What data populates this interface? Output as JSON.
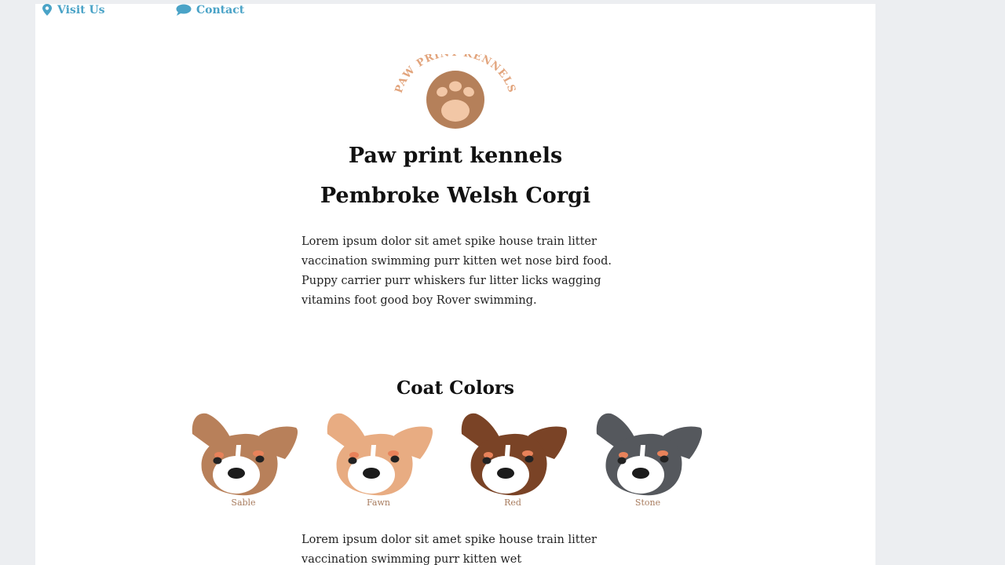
{
  "nav": {
    "visit_label": "Visit Us",
    "contact_label": "Contact"
  },
  "logo": {
    "arc_text": "PAW PRINT KENNELS"
  },
  "header": {
    "site_title": "Paw print kennels",
    "breed_title": "Pembroke Welsh Corgi"
  },
  "intro": {
    "paragraph": "Lorem ipsum dolor sit amet spike house train litter vaccination swimming purr kitten wet nose bird food. Puppy carrier purr whiskers fur litter licks wagging vitamins foot good boy Rover swimming."
  },
  "coat_colors": {
    "title": "Coat Colors",
    "items": [
      {
        "label": "Sable",
        "color": "#b8805a"
      },
      {
        "label": "Fawn",
        "color": "#e8ac82"
      },
      {
        "label": "Red",
        "color": "#7a4326"
      },
      {
        "label": "Stone",
        "color": "#55585d"
      }
    ]
  },
  "second": {
    "paragraph": "Lorem ipsum dolor sit amet spike house train litter vaccination swimming purr kitten wet"
  },
  "colors": {
    "accent": "#4aa3c7",
    "logo_brown": "#b5805a",
    "logo_light": "#f2c7a6",
    "label_color": "#a87c5f"
  }
}
